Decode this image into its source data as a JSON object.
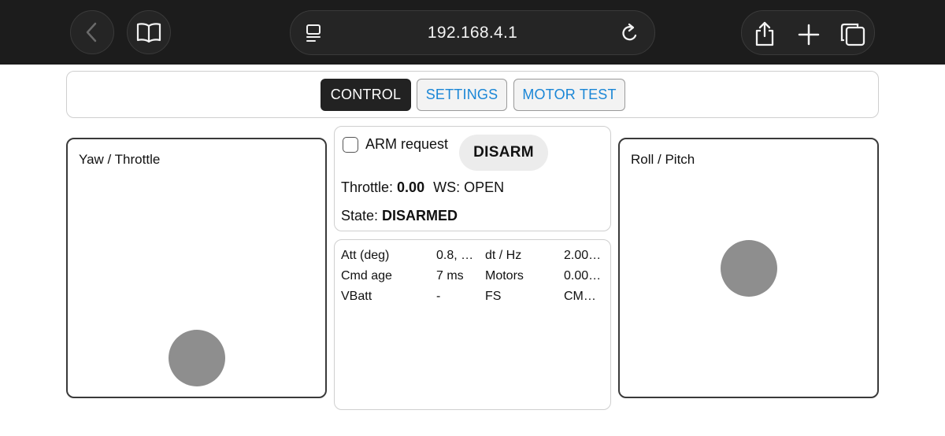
{
  "browser": {
    "address": "192.168.4.1",
    "icons": {
      "back": "chevron-left-icon",
      "bookmarks": "book-icon",
      "reader": "reader-icon",
      "reload": "reload-icon",
      "share": "share-icon",
      "new_tab": "plus-icon",
      "tabs": "tabs-icon"
    }
  },
  "tabs": [
    {
      "label": "CONTROL",
      "active": true
    },
    {
      "label": "SETTINGS",
      "active": false
    },
    {
      "label": "MOTOR TEST",
      "active": false
    }
  ],
  "left_stick": {
    "label": "Yaw / Throttle"
  },
  "right_stick": {
    "label": "Roll / Pitch"
  },
  "status": {
    "arm_request_label": "ARM request",
    "arm_request_checked": false,
    "disarm_button": "DISARM",
    "throttle_label": "Throttle:",
    "throttle_value": "0.00",
    "ws_label": "WS:",
    "ws_value": "OPEN",
    "state_label": "State:",
    "state_value": "DISARMED"
  },
  "telemetry": [
    {
      "label": "Att (deg)",
      "value": "0.8, …",
      "label2": "dt / Hz",
      "value2": "2.00…"
    },
    {
      "label": "Cmd age",
      "value": "7 ms",
      "label2": "Motors",
      "value2": "0.00…"
    },
    {
      "label": "VBatt",
      "value": "-",
      "label2": "FS",
      "value2": "CM…"
    }
  ],
  "colors": {
    "chrome_bg": "#1c1c1c",
    "tab_active_bg": "#222222",
    "tab_link": "#1a86d6",
    "knob": "#8e8e8e"
  }
}
